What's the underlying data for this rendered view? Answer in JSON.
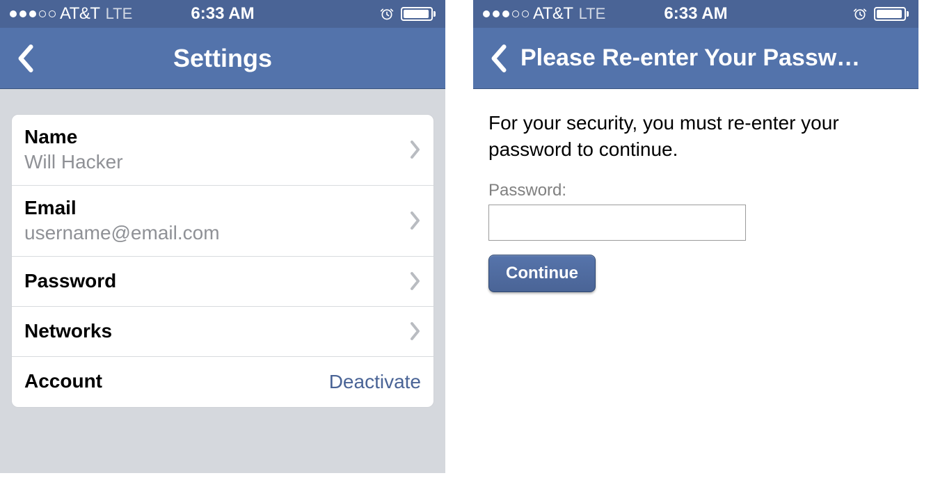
{
  "status": {
    "carrier": "AT&T",
    "network": "LTE",
    "time": "6:33 AM"
  },
  "left": {
    "title": "Settings",
    "rows": {
      "name": {
        "label": "Name",
        "value": "Will Hacker"
      },
      "email": {
        "label": "Email",
        "value": "username@email.com"
      },
      "password": {
        "label": "Password"
      },
      "networks": {
        "label": "Networks"
      },
      "account": {
        "label": "Account",
        "action": "Deactivate"
      }
    }
  },
  "right": {
    "title": "Please Re-enter Your Passw…",
    "instruction": "For your security, you must re-enter your password to continue.",
    "password_label": "Password:",
    "continue_label": "Continue"
  },
  "colors": {
    "nav_bg": "#5373ab",
    "status_bg": "#4a6496",
    "accent": "#4a6496"
  }
}
